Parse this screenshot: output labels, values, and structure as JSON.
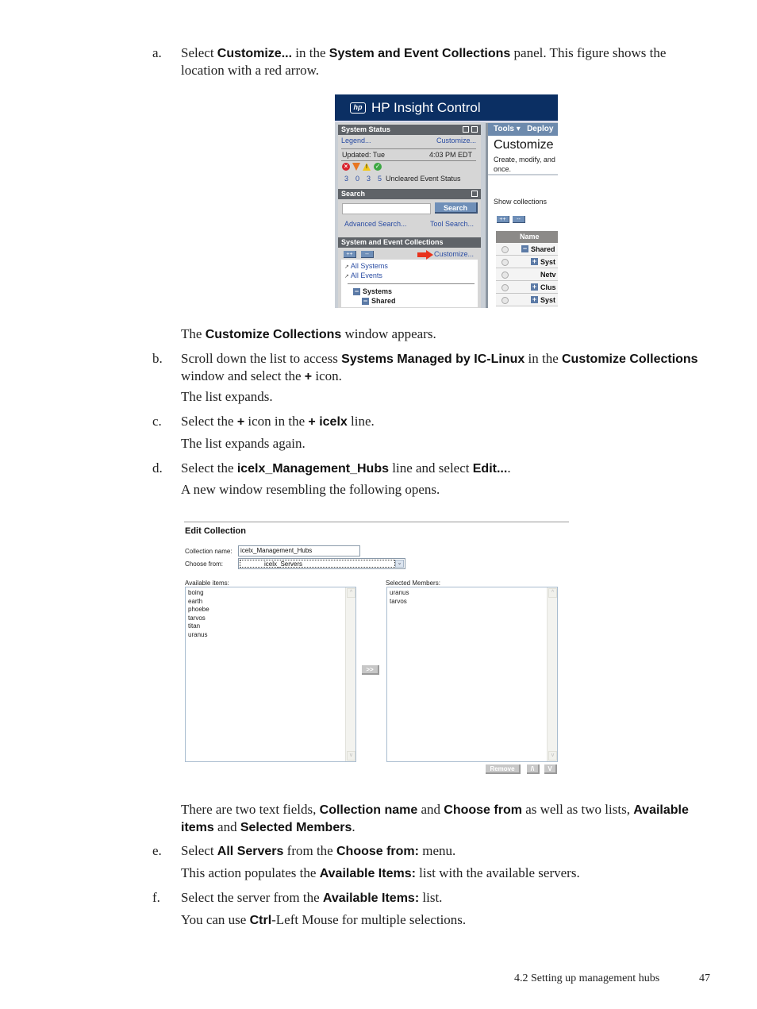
{
  "steps": {
    "a": {
      "marker": "a.",
      "t1": "Select ",
      "b1": "Customize...",
      "t2": " in the ",
      "b2": "System and Event Collections",
      "t3": " panel. This figure shows the location with a red arrow."
    },
    "a_result": {
      "t1": "The ",
      "b1": "Customize Collections",
      "t2": " window appears."
    },
    "b": {
      "marker": "b.",
      "t1": "Scroll down the list to access ",
      "b1": "Systems Managed by IC-Linux",
      "t2": " in the ",
      "b2": "Customize Collections",
      "t3": " window and select the ",
      "b3": "+",
      "t4": " icon."
    },
    "b_result": "The list expands.",
    "c": {
      "marker": "c.",
      "t1": "Select the ",
      "b1": "+",
      "t2": " icon in the ",
      "b2": "+ icelx",
      "t3": " line."
    },
    "c_result": "The list expands again.",
    "d": {
      "marker": "d.",
      "t1": "Select the ",
      "b1": "icelx_Management_Hubs",
      "t2": " line and select ",
      "b2": "Edit...",
      "t3": "."
    },
    "d_result": "A new window resembling the following opens.",
    "d_note": {
      "t1": "There are two text fields, ",
      "b1": "Collection name",
      "t2": " and ",
      "b2": "Choose from",
      "t3": " as well as two lists, ",
      "b3": "Available items",
      "t4": " and ",
      "b4": "Selected Members",
      "t5": "."
    },
    "e": {
      "marker": "e.",
      "t1": "Select ",
      "b1": "All Servers",
      "t2": " from the ",
      "b2": "Choose from:",
      "t3": " menu."
    },
    "e_result": {
      "t1": "This action populates the ",
      "b1": "Available Items:",
      "t2": " list with the available servers."
    },
    "f": {
      "marker": "f.",
      "t1": "Select the server from the ",
      "b1": "Available Items:",
      "t2": " list."
    },
    "f_result": {
      "t1": "You can use ",
      "b1": "Ctrl",
      "t2": "-Left Mouse for multiple selections."
    }
  },
  "figure1": {
    "app_title": "HP Insight Control",
    "logo_text": "hp",
    "system_status": {
      "title": "System Status",
      "legend_link": "Legend...",
      "customize_link": "Customize...",
      "updated_label": "Updated: Tue",
      "updated_time": "4:03 PM EDT",
      "counts": [
        "3",
        "0",
        "3",
        "5"
      ],
      "counts_label": "Uncleared Event Status",
      "status_colors": {
        "critical": "#d9232e",
        "major": "#e87722",
        "minor": "#f2c81a",
        "normal": "#3ca843"
      }
    },
    "search": {
      "title": "Search",
      "input_value": "",
      "button_label": "Search",
      "advanced_link": "Advanced Search...",
      "tool_link": "Tool Search..."
    },
    "collections": {
      "title": "System and Event Collections",
      "expand_label": "++",
      "collapse_label": "--",
      "customize_link": "Customize...",
      "items": [
        "All Systems",
        "All Events"
      ],
      "tree": [
        "Systems",
        "Shared"
      ],
      "arrow_color": "#e8321c"
    },
    "right_panel": {
      "tools_menu": "Tools ▾",
      "deploy_menu": "Deploy",
      "heading": "Customize",
      "description_line1": "Create, modify, and",
      "description_line2": "once.",
      "show_collections": "Show collections",
      "expand_label": "++",
      "collapse_label": "--",
      "table_header": "Name",
      "rows": [
        {
          "toggle": "−",
          "label": "Shared"
        },
        {
          "toggle": "+",
          "label": "Syst"
        },
        {
          "toggle": "",
          "label": "Netv"
        },
        {
          "toggle": "+",
          "label": "Clus"
        },
        {
          "toggle": "+",
          "label": "Syst"
        }
      ]
    },
    "header_color": "#0b2f63"
  },
  "figure2": {
    "title": "Edit Collection",
    "collection_name_label": "Collection name:",
    "collection_name_value": "icelx_Management_Hubs",
    "choose_from_label": "Choose from:",
    "choose_from_value": "icelx_Servers",
    "available_label": "Available items:",
    "available_items": [
      "boing",
      "earth",
      "phoebe",
      "tarvos",
      "titan",
      "uranus"
    ],
    "selected_label": "Selected Members:",
    "selected_items": [
      "uranus",
      "tarvos"
    ],
    "add_button": ">>",
    "remove_button": "Remove",
    "up_button": "/\\",
    "down_button": "V"
  },
  "footer": {
    "section": "4.2 Setting up management hubs",
    "page_number": "47"
  }
}
